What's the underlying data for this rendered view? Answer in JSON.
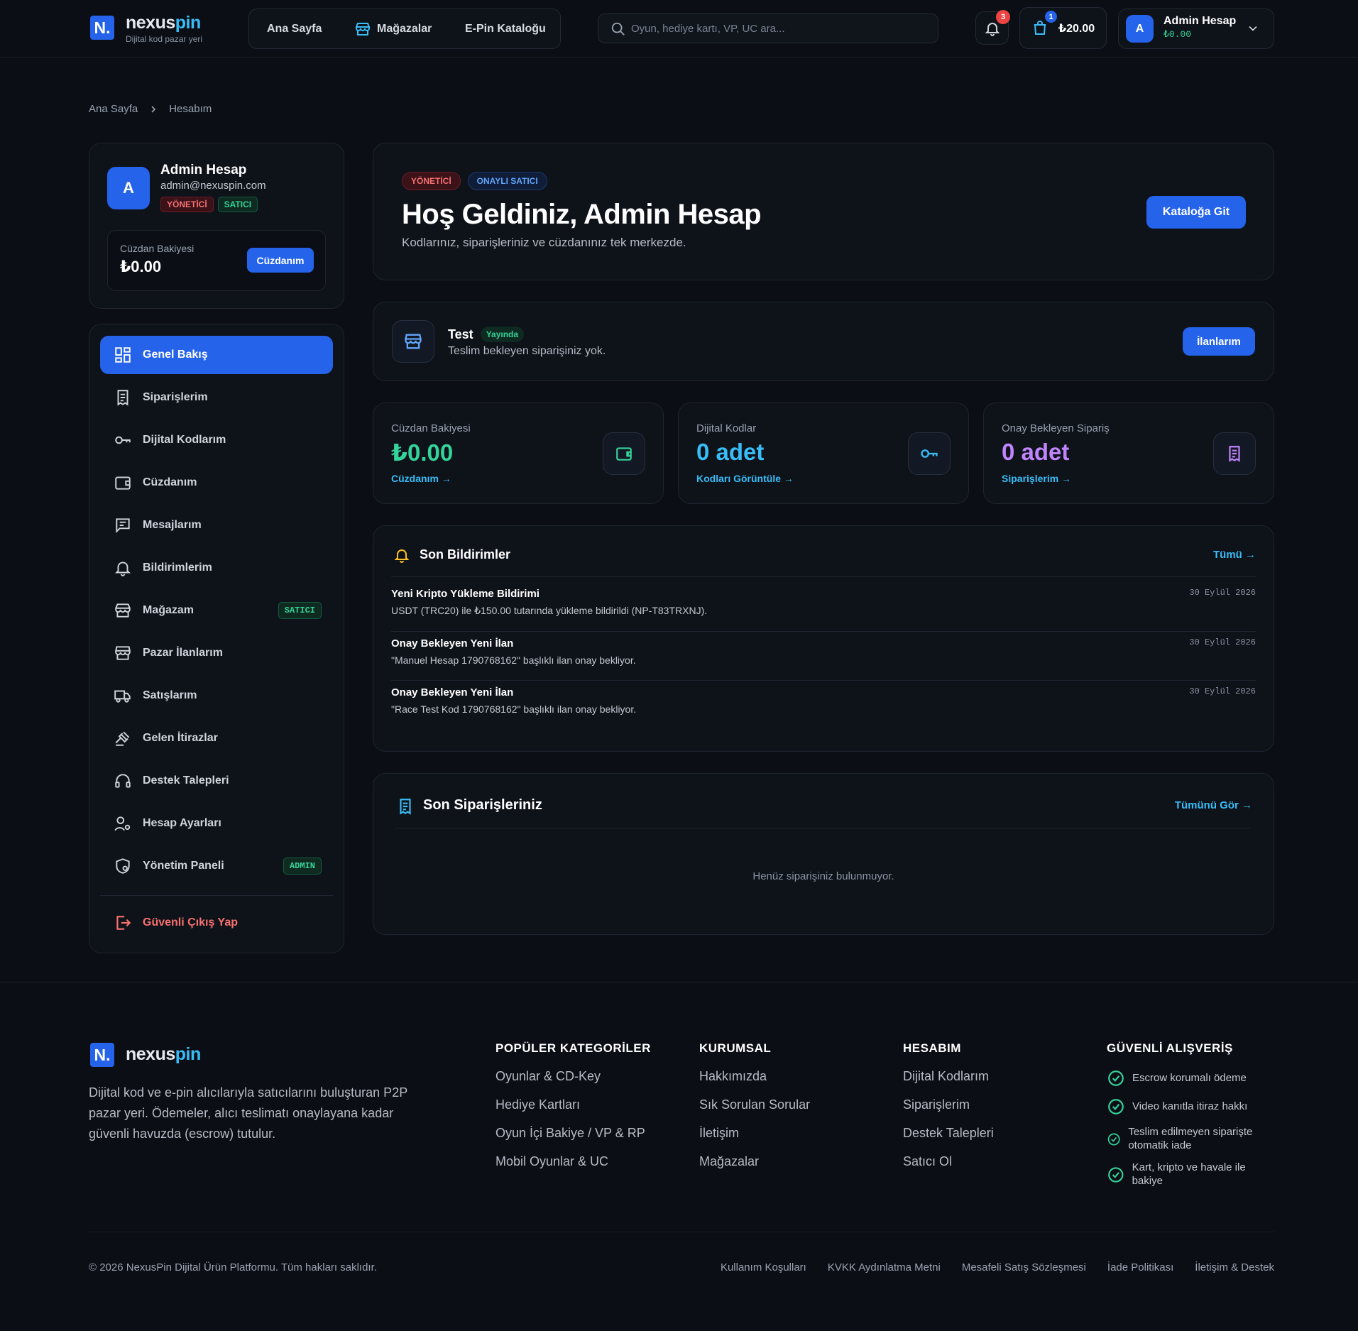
{
  "header": {
    "logo_letter": "N.",
    "logo_name_1": "nexus",
    "logo_name_2": "pin",
    "logo_tagline": "Dijital kod pazar yeri",
    "nav": [
      "Ana Sayfa",
      "Mağazalar",
      "E-Pin Kataloğu"
    ],
    "search_placeholder": "Oyun, hediye kartı, VP, UC ara...",
    "notification_count": "3",
    "cart_count": "1",
    "cart_total": "₺20.00",
    "user_initial": "A",
    "user_name": "Admin Hesap",
    "user_balance": "₺0.00"
  },
  "breadcrumb": [
    "Ana Sayfa",
    "Hesabım"
  ],
  "profile": {
    "initial": "A",
    "name": "Admin Hesap",
    "email": "admin@nexuspin.com",
    "badges": [
      "YÖNETİCİ",
      "SATICI"
    ],
    "wallet_label": "Cüzdan Bakiyesi",
    "wallet_value": "₺0.00",
    "wallet_button": "Cüzdanım"
  },
  "sidebar": {
    "items": [
      {
        "label": "Genel Bakış",
        "icon": "dashboard-icon",
        "active": true
      },
      {
        "label": "Siparişlerim",
        "icon": "receipt-icon"
      },
      {
        "label": "Dijital Kodlarım",
        "icon": "key-icon"
      },
      {
        "label": "Cüzdanım",
        "icon": "wallet-icon"
      },
      {
        "label": "Mesajlarım",
        "icon": "message-icon"
      },
      {
        "label": "Bildirimlerim",
        "icon": "bell-icon"
      },
      {
        "label": "Mağazam",
        "icon": "store-icon",
        "badge": "SATICI"
      },
      {
        "label": "Pazar İlanlarım",
        "icon": "storefront-icon"
      },
      {
        "label": "Satışlarım",
        "icon": "truck-icon"
      },
      {
        "label": "Gelen İtirazlar",
        "icon": "gavel-icon"
      },
      {
        "label": "Destek Talepleri",
        "icon": "headset-icon"
      },
      {
        "label": "Hesap Ayarları",
        "icon": "user-settings-icon"
      },
      {
        "label": "Yönetim Paneli",
        "icon": "shield-icon",
        "badge": "ADMIN"
      }
    ],
    "logout": "Güvenli Çıkış Yap"
  },
  "welcome": {
    "tags": [
      "YÖNETİCİ",
      "ONAYLI SATICI"
    ],
    "title": "Hoş Geldiniz, Admin Hesap",
    "subtitle": "Kodlarınız, siparişleriniz ve cüzdanınız tek merkezde.",
    "button": "Kataloğa Git"
  },
  "store": {
    "name": "Test",
    "status": "Yayında",
    "text": "Teslim bekleyen siparişiniz yok.",
    "button": "İlanlarım"
  },
  "stats": [
    {
      "label": "Cüzdan Bakiyesi",
      "value": "₺0.00",
      "link": "Cüzdanım →",
      "color": "#34d399",
      "icon": "wallet-icon"
    },
    {
      "label": "Dijital Kodlar",
      "value": "0 adet",
      "link": "Kodları Görüntüle →",
      "color": "#38bdf8",
      "icon": "key-icon"
    },
    {
      "label": "Onay Bekleyen Sipariş",
      "value": "0 adet",
      "link": "Siparişlerim →",
      "color": "#c084fc",
      "icon": "receipt-icon"
    }
  ],
  "notifications": {
    "title": "Son Bildirimler",
    "link": "Tümü →",
    "items": [
      {
        "title": "Yeni Kripto Yükleme Bildirimi",
        "text": "USDT (TRC20) ile ₺150.00 tutarında yükleme bildirildi (NP-T83TRXNJ).",
        "date": "30 Eylül 2026"
      },
      {
        "title": "Onay Bekleyen Yeni İlan",
        "text": "\"Manuel Hesap 1790768162\" başlıklı ilan onay bekliyor.",
        "date": "30 Eylül 2026"
      },
      {
        "title": "Onay Bekleyen Yeni İlan",
        "text": "\"Race Test Kod 1790768162\" başlıklı ilan onay bekliyor.",
        "date": "30 Eylül 2026"
      }
    ]
  },
  "orders": {
    "title": "Son Siparişleriniz",
    "link": "Tümünü Gör →",
    "empty": "Henüz siparişiniz bulunmuyor."
  },
  "footer": {
    "logo_name_1": "nexus",
    "logo_name_2": "pin",
    "description": "Dijital kod ve e-pin alıcılarıyla satıcılarını buluşturan P2P pazar yeri. Ödemeler, alıcı teslimatı onaylayana kadar güvenli havuzda (escrow) tutulur.",
    "columns": [
      {
        "title": "POPÜLER KATEGORİLER",
        "links": [
          "Oyunlar & CD-Key",
          "Hediye Kartları",
          "Oyun İçi Bakiye / VP & RP",
          "Mobil Oyunlar & UC"
        ]
      },
      {
        "title": "KURUMSAL",
        "links": [
          "Hakkımızda",
          "Sık Sorulan Sorular",
          "İletişim",
          "Mağazalar"
        ]
      },
      {
        "title": "HESABIM",
        "links": [
          "Dijital Kodlarım",
          "Siparişlerim",
          "Destek Talepleri",
          "Satıcı Ol"
        ]
      }
    ],
    "secure_title": "GÜVENLİ ALIŞVERİŞ",
    "secure_items": [
      "Escrow korumalı ödeme",
      "Video kanıtla itiraz hakkı",
      "Teslim edilmeyen siparişte otomatik iade",
      "Kart, kripto ve havale ile bakiye"
    ],
    "copyright": "© 2026 NexusPin Dijital Ürün Platformu. Tüm hakları saklıdır.",
    "bottom_links": [
      "Kullanım Koşulları",
      "KVKK Aydınlatma Metni",
      "Mesafeli Satış Sözleşmesi",
      "İade Politikası",
      "İletişim & Destek"
    ]
  }
}
